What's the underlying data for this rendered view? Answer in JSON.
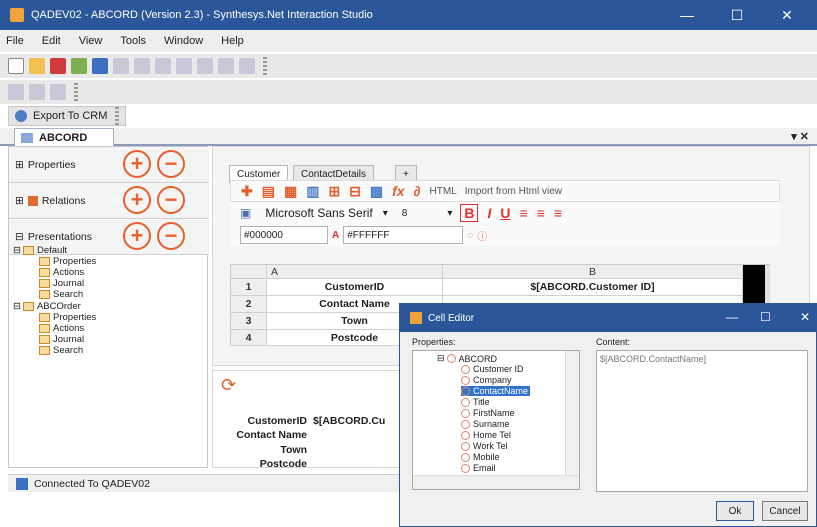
{
  "window": {
    "title": "QADEV02 - ABCORD (Version 2.3) - Synthesys.Net Interaction Studio",
    "minimize": "—",
    "maximize": "☐",
    "close": "✕"
  },
  "menu": [
    "File",
    "Edit",
    "View",
    "Tools",
    "Window",
    "Help"
  ],
  "toolbar": {
    "export_label": "Export To CRM"
  },
  "document_tab": {
    "label": "ABCORD",
    "controls": "▾ ✕"
  },
  "left_panel": {
    "sections": [
      {
        "label": "Properties",
        "expander": "⊞"
      },
      {
        "label": "Relations",
        "expander": "⊞"
      },
      {
        "label": "Presentations",
        "expander": "⊟"
      }
    ],
    "plus": "+",
    "minus": "−",
    "tree": [
      {
        "label": "Default",
        "level": 0
      },
      {
        "label": "Properties",
        "level": 1
      },
      {
        "label": "Actions",
        "level": 1
      },
      {
        "label": "Journal",
        "level": 1
      },
      {
        "label": "Search",
        "level": 1
      },
      {
        "label": "ABCOrder",
        "level": 0
      },
      {
        "label": "Properties",
        "level": 1
      },
      {
        "label": "Actions",
        "level": 1
      },
      {
        "label": "Journal",
        "level": 1
      },
      {
        "label": "Search",
        "level": 1
      }
    ]
  },
  "editor": {
    "tabs": [
      "Customer",
      "ContactDetails",
      "+"
    ],
    "toolbar_text": {
      "html": "HTML",
      "import": "Import from Html view"
    },
    "font_name": "Microsoft Sans Serif",
    "font_size": "8",
    "font_style_buttons": [
      "B",
      "I",
      "U"
    ],
    "fore_color": "#000000",
    "back_color": "#FFFFFF",
    "grid": {
      "col_headers": [
        "A",
        "B"
      ],
      "rows": [
        {
          "num": "1",
          "a": "CustomerID",
          "b": "$[ABCORD.Customer ID]"
        },
        {
          "num": "2",
          "a": "Contact Name",
          "b": ""
        },
        {
          "num": "3",
          "a": "Town",
          "b": ""
        },
        {
          "num": "4",
          "a": "Postcode",
          "b": ""
        }
      ]
    }
  },
  "preview": {
    "refresh_icon": "⟳",
    "rows": [
      {
        "label": "CustomerID",
        "value": "$[ABCORD.Cu"
      },
      {
        "label": "Contact Name",
        "value": ""
      },
      {
        "label": "Town",
        "value": ""
      },
      {
        "label": "Postcode",
        "value": ""
      }
    ]
  },
  "status": {
    "text": "Connected To QADEV02"
  },
  "cell_editor": {
    "title": "Cell Editor",
    "properties_label": "Properties:",
    "content_label": "Content:",
    "content_value": "$[ABCORD.ContactName]",
    "tree_root": "ABCORD",
    "tree_items": [
      "Customer ID",
      "Company",
      "ContactName",
      "Title",
      "FirstName",
      "Surname",
      "Home Tel",
      "Work Tel",
      "Mobile",
      "Email"
    ],
    "selected_item": "ContactName",
    "ok_label": "Ok",
    "cancel_label": "Cancel"
  },
  "colors": {
    "titlebar": "#2b579a",
    "accent_orange": "#e8602c",
    "bold_red": "#e03030"
  }
}
